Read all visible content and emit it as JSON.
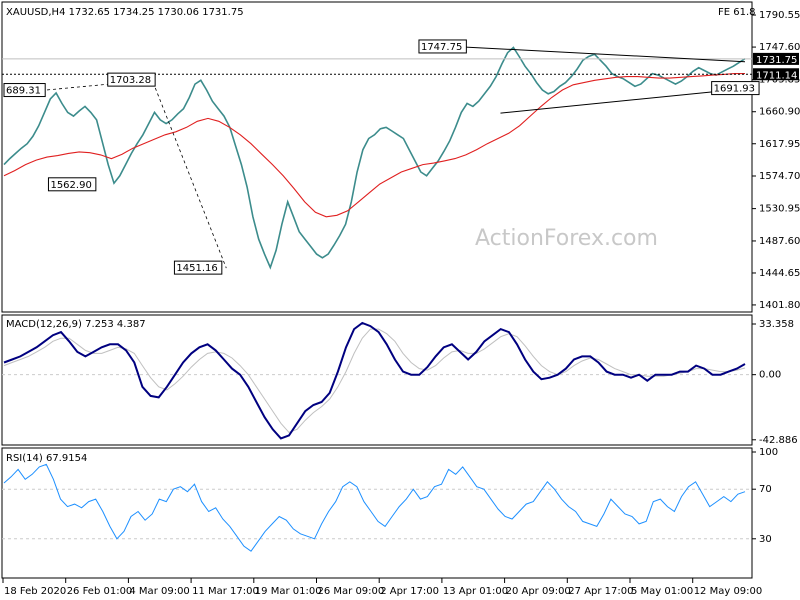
{
  "chart_data": {
    "type": "candlestick",
    "symbol_header": "XAUUSD,H4  1732.65 1734.25 1730.06 1731.75",
    "fib_label": "FE 61.8",
    "watermark": "ActionForex.com",
    "x_axis": {
      "tick_labels": [
        "18 Feb 2020",
        "26 Feb 01:00",
        "4 Mar 09:00",
        "11 Mar 17:00",
        "19 Mar 01:00",
        "26 Mar 09:00",
        "2 Apr 17:00",
        "13 Apr 01:00",
        "20 Apr 09:00",
        "27 Apr 17:00",
        "5 May 01:00",
        "12 May 09:00"
      ]
    },
    "price_panel": {
      "y_ticks": [
        1790.55,
        1747.6,
        1703.85,
        1660.9,
        1617.95,
        1574.7,
        1530.95,
        1487.6,
        1444.65,
        1401.8
      ],
      "ylim": [
        1395,
        1800
      ],
      "current_price": 1731.75,
      "support_level": 1711.14,
      "annotations": [
        {
          "label": "689.31",
          "price": 1689.31
        },
        {
          "label": "1703.28",
          "price": 1703.28
        },
        {
          "label": "1562.90",
          "price": 1562.9
        },
        {
          "label": "1451.16",
          "price": 1451.16
        },
        {
          "label": "1747.75",
          "price": 1747.75
        },
        {
          "label": "1691.93",
          "price": 1691.93
        }
      ],
      "price_series": [
        1590,
        1598,
        1605,
        1612,
        1618,
        1628,
        1642,
        1660,
        1678,
        1686,
        1672,
        1660,
        1655,
        1662,
        1668,
        1660,
        1650,
        1620,
        1590,
        1565,
        1575,
        1590,
        1605,
        1618,
        1630,
        1645,
        1660,
        1650,
        1645,
        1650,
        1658,
        1665,
        1680,
        1698,
        1703,
        1690,
        1675,
        1665,
        1655,
        1640,
        1615,
        1590,
        1560,
        1520,
        1490,
        1470,
        1452,
        1475,
        1510,
        1540,
        1520,
        1500,
        1490,
        1480,
        1470,
        1465,
        1470,
        1482,
        1495,
        1510,
        1540,
        1580,
        1610,
        1625,
        1630,
        1638,
        1640,
        1635,
        1630,
        1625,
        1610,
        1595,
        1580,
        1575,
        1585,
        1595,
        1608,
        1622,
        1640,
        1660,
        1672,
        1668,
        1675,
        1685,
        1695,
        1708,
        1725,
        1740,
        1747,
        1735,
        1722,
        1712,
        1700,
        1690,
        1685,
        1688,
        1695,
        1700,
        1708,
        1718,
        1730,
        1735,
        1738,
        1730,
        1722,
        1712,
        1708,
        1705,
        1700,
        1695,
        1698,
        1705,
        1712,
        1710,
        1706,
        1702,
        1698,
        1702,
        1708,
        1715,
        1720,
        1716,
        1712,
        1710,
        1714,
        1718,
        1722,
        1727,
        1732
      ],
      "ma_series": [
        1575,
        1582,
        1590,
        1596,
        1600,
        1602,
        1605,
        1607,
        1606,
        1603,
        1598,
        1604,
        1612,
        1618,
        1624,
        1630,
        1634,
        1640,
        1648,
        1652,
        1648,
        1640,
        1630,
        1618,
        1604,
        1590,
        1575,
        1558,
        1540,
        1526,
        1520,
        1522,
        1528,
        1540,
        1552,
        1564,
        1572,
        1580,
        1585,
        1590,
        1592,
        1595,
        1598,
        1603,
        1610,
        1618,
        1625,
        1632,
        1642,
        1655,
        1668,
        1680,
        1690,
        1697,
        1700,
        1703,
        1705,
        1707,
        1708,
        1708,
        1707,
        1706,
        1706,
        1707,
        1708,
        1709,
        1710,
        1711,
        1712,
        1712
      ],
      "triangle_upper": [
        [
          1747.75,
          0
        ],
        [
          1728,
          1
        ]
      ],
      "triangle_lower": [
        [
          1659,
          0
        ],
        [
          1691.93,
          1
        ]
      ]
    },
    "macd_panel": {
      "label": "MACD(12,26,9) 7.253 4.387",
      "y_ticks": [
        33.358,
        0.0,
        -42.886
      ],
      "ylim": [
        -45,
        36
      ],
      "macd_series": [
        8,
        10,
        12,
        15,
        18,
        22,
        26,
        28,
        22,
        15,
        12,
        15,
        18,
        20,
        20,
        16,
        8,
        -8,
        -14,
        -15,
        -8,
        0,
        8,
        14,
        18,
        20,
        16,
        10,
        4,
        0,
        -8,
        -18,
        -28,
        -36,
        -42,
        -40,
        -32,
        -24,
        -20,
        -18,
        -12,
        2,
        18,
        30,
        34,
        32,
        28,
        20,
        10,
        2,
        0,
        0,
        5,
        12,
        18,
        20,
        15,
        10,
        15,
        22,
        26,
        30,
        28,
        20,
        10,
        2,
        -3,
        -2,
        0,
        4,
        10,
        12,
        12,
        8,
        2,
        0,
        0,
        -2,
        0,
        -4,
        0,
        0,
        0,
        2,
        2,
        6,
        4,
        0,
        0,
        2,
        4,
        7
      ],
      "signal_series": [
        6,
        8,
        10,
        12,
        15,
        18,
        22,
        24,
        24,
        20,
        16,
        14,
        14,
        16,
        18,
        17,
        14,
        6,
        -2,
        -8,
        -10,
        -6,
        -1,
        5,
        10,
        14,
        15,
        14,
        11,
        6,
        0,
        -8,
        -16,
        -24,
        -32,
        -38,
        -36,
        -30,
        -25,
        -21,
        -16,
        -8,
        2,
        14,
        24,
        30,
        30,
        27,
        22,
        14,
        8,
        4,
        3,
        6,
        11,
        15,
        16,
        14,
        14,
        17,
        21,
        25,
        27,
        25,
        19,
        12,
        6,
        2,
        0,
        2,
        6,
        9,
        11,
        10,
        7,
        4,
        2,
        0,
        0,
        -1,
        -1,
        -1,
        0,
        1,
        2,
        4,
        4,
        3,
        2,
        2,
        3,
        4.4
      ]
    },
    "rsi_panel": {
      "label": "RSI(14) 67.9154",
      "y_ticks": [
        100,
        70,
        30
      ],
      "ylim": [
        0,
        100
      ],
      "rsi_series": [
        75,
        80,
        86,
        78,
        82,
        88,
        90,
        78,
        62,
        56,
        58,
        55,
        60,
        62,
        52,
        40,
        30,
        36,
        48,
        52,
        45,
        50,
        62,
        60,
        70,
        72,
        68,
        74,
        60,
        52,
        55,
        46,
        40,
        32,
        24,
        20,
        28,
        36,
        42,
        48,
        45,
        38,
        34,
        32,
        30,
        42,
        52,
        60,
        72,
        76,
        72,
        60,
        52,
        44,
        40,
        48,
        56,
        62,
        70,
        62,
        64,
        72,
        74,
        86,
        82,
        88,
        80,
        72,
        70,
        62,
        54,
        48,
        46,
        52,
        58,
        60,
        68,
        76,
        70,
        62,
        56,
        52,
        44,
        42,
        40,
        50,
        62,
        56,
        50,
        48,
        42,
        44,
        60,
        62,
        56,
        52,
        64,
        72,
        76,
        66,
        56,
        60,
        64,
        60,
        66,
        68
      ]
    },
    "colors": {
      "price": "#3c8c8c",
      "ma": "#e02020",
      "macd": "#000080",
      "signal": "#c0c0c0",
      "rsi": "#1e90ff",
      "grid": "#cccccc",
      "label_bg": "#000000"
    }
  }
}
